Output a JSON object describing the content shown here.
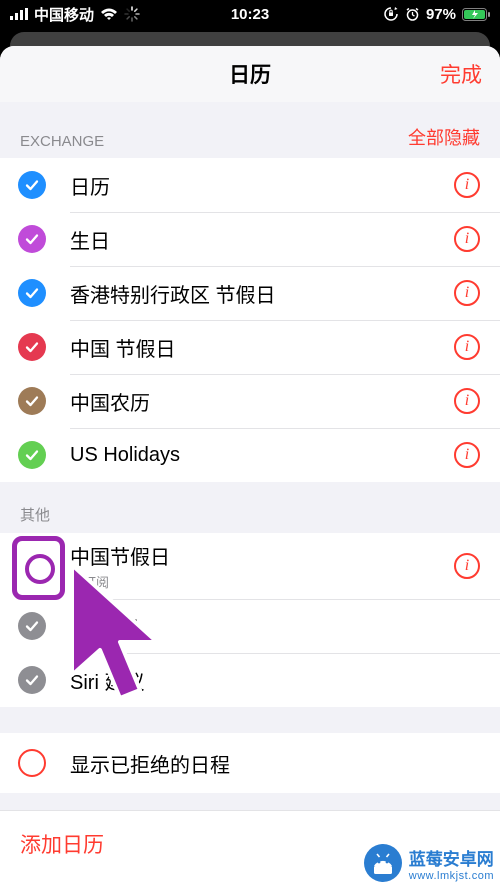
{
  "statusbar": {
    "carrier": "中国移动",
    "time": "10:23",
    "battery_pct": "97%"
  },
  "sheet": {
    "title": "日历",
    "done": "完成"
  },
  "sections": {
    "exchange": {
      "title": "EXCHANGE",
      "hide_all": "全部隐藏",
      "items": [
        {
          "label": "日历",
          "color": "#1f8fff",
          "checked": true
        },
        {
          "label": "生日",
          "color": "#c04bd9",
          "checked": true
        },
        {
          "label": "香港特别行政区 节假日",
          "color": "#1f8fff",
          "checked": true
        },
        {
          "label": "中国 节假日",
          "color": "#e53950",
          "checked": true
        },
        {
          "label": "中国农历",
          "color": "#9e7b57",
          "checked": true
        },
        {
          "label": "US Holidays",
          "color": "#63cf52",
          "checked": true
        }
      ]
    },
    "other": {
      "title": "其他",
      "items": [
        {
          "label": "中国节假日",
          "sublabel": "已订阅",
          "color": "#ffffff",
          "checked": false,
          "info": true
        },
        {
          "label": "生日",
          "color": "#8e8e93",
          "checked": true,
          "gift": true,
          "info": false
        },
        {
          "label": "Siri 建议",
          "sublabel_hidden": true,
          "color": "#8e8e93",
          "checked": true,
          "info": false
        }
      ]
    },
    "declined": {
      "items": [
        {
          "label": "显示已拒绝的日程",
          "checked": false
        }
      ]
    }
  },
  "footer": {
    "add_calendar": "添加日历"
  },
  "watermark": {
    "line1": "蓝莓安卓网",
    "line2": "www.lmkjst.com"
  }
}
